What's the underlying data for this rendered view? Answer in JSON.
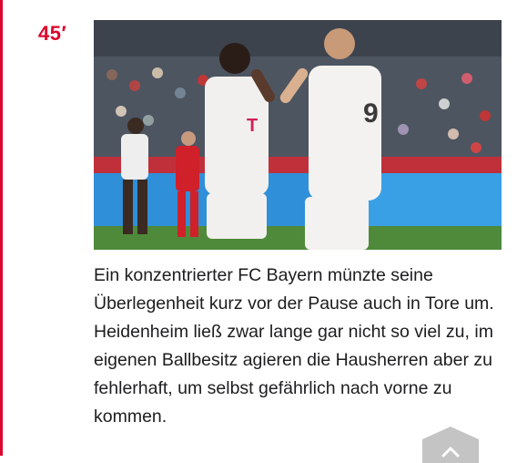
{
  "theme": {
    "accent": "#dc052d",
    "text": "#1d1d1f",
    "scroll_button_bg": "#c4c4c4"
  },
  "entry": {
    "minute": "45′",
    "photo_icon": "match-photo",
    "text": "Ein konzentrierter FC Bayern münzte seine Überlegenheit kurz vor der Pause auch in Tore um. Heidenheim ließ zwar lange gar nicht so viel zu, im eigenen Ballbesitz agieren die Hausherren aber zu fehlerhaft, um selbst gefährlich nach vorne zu kommen."
  },
  "scroll_top": {
    "icon": "chevron-up-icon"
  }
}
